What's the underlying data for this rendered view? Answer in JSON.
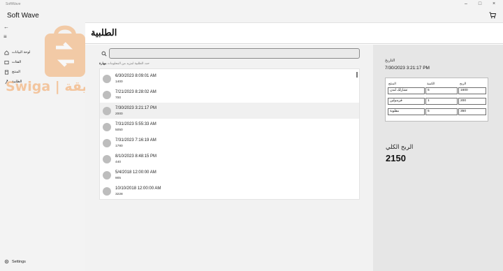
{
  "window": {
    "title": "SoftWave"
  },
  "app": {
    "title": "Soft Wave"
  },
  "nav": {
    "items": [
      {
        "label": "لوحة البيانات"
      },
      {
        "label": "الفئات"
      },
      {
        "label": "المنتج"
      },
      {
        "label": "الطلبية"
      }
    ],
    "settings": "Settings"
  },
  "watermark": {
    "text": "Swiga | سويقة"
  },
  "page": {
    "title": "الطلبية"
  },
  "search": {
    "placeholder": "",
    "hint_text": "حدد الطلبية لمزيد من المعلومات",
    "hint_bold": "مهارة"
  },
  "orders": [
    {
      "date": "6/30/2023 8:09:01 AM",
      "amount": "1400"
    },
    {
      "date": "7/21/2023 8:28:02 AM",
      "amount": "700"
    },
    {
      "date": "7/30/2023 3:21:17 PM",
      "amount": "2000"
    },
    {
      "date": "7/31/2023 5:55:33 AM",
      "amount": "5050"
    },
    {
      "date": "7/31/2023 7:16:19 AM",
      "amount": "1780"
    },
    {
      "date": "8/10/2023 8:48:15 PM",
      "amount": "440"
    },
    {
      "date": "5/4/2018 12:00:00 AM",
      "amount": "905"
    },
    {
      "date": "10/10/2018 12:00:00 AM",
      "amount": "3228"
    }
  ],
  "selected_order_index": 2,
  "detail": {
    "date_label": "التاريخ",
    "date_value": "7/30/2023 3:21:17 PM",
    "table": {
      "headers": {
        "product": "المنتج",
        "quantity": "الكمية",
        "profit": "الربح"
      },
      "rows": [
        {
          "product": "تشارلك لندن",
          "quantity": "5",
          "profit": "1600"
        },
        {
          "product": "فريدولين",
          "quantity": "1",
          "profit": "200"
        },
        {
          "product": "مقلوبة",
          "quantity": "5",
          "profit": "350"
        }
      ]
    },
    "total_profit_label": "الربح الكلي",
    "total_profit_value": "2150"
  },
  "colors": {
    "selected_row": "#f0f0f0",
    "avatar": "#bdbdbd",
    "detail_bg": "#e6e6e6",
    "watermark": "#f3a15a"
  },
  "icons": [
    "cart-icon",
    "back-arrow-icon",
    "hamburger-icon",
    "dashboard-icon",
    "categories-icon",
    "product-icon",
    "orders-icon",
    "settings-gear-icon",
    "search-icon"
  ]
}
